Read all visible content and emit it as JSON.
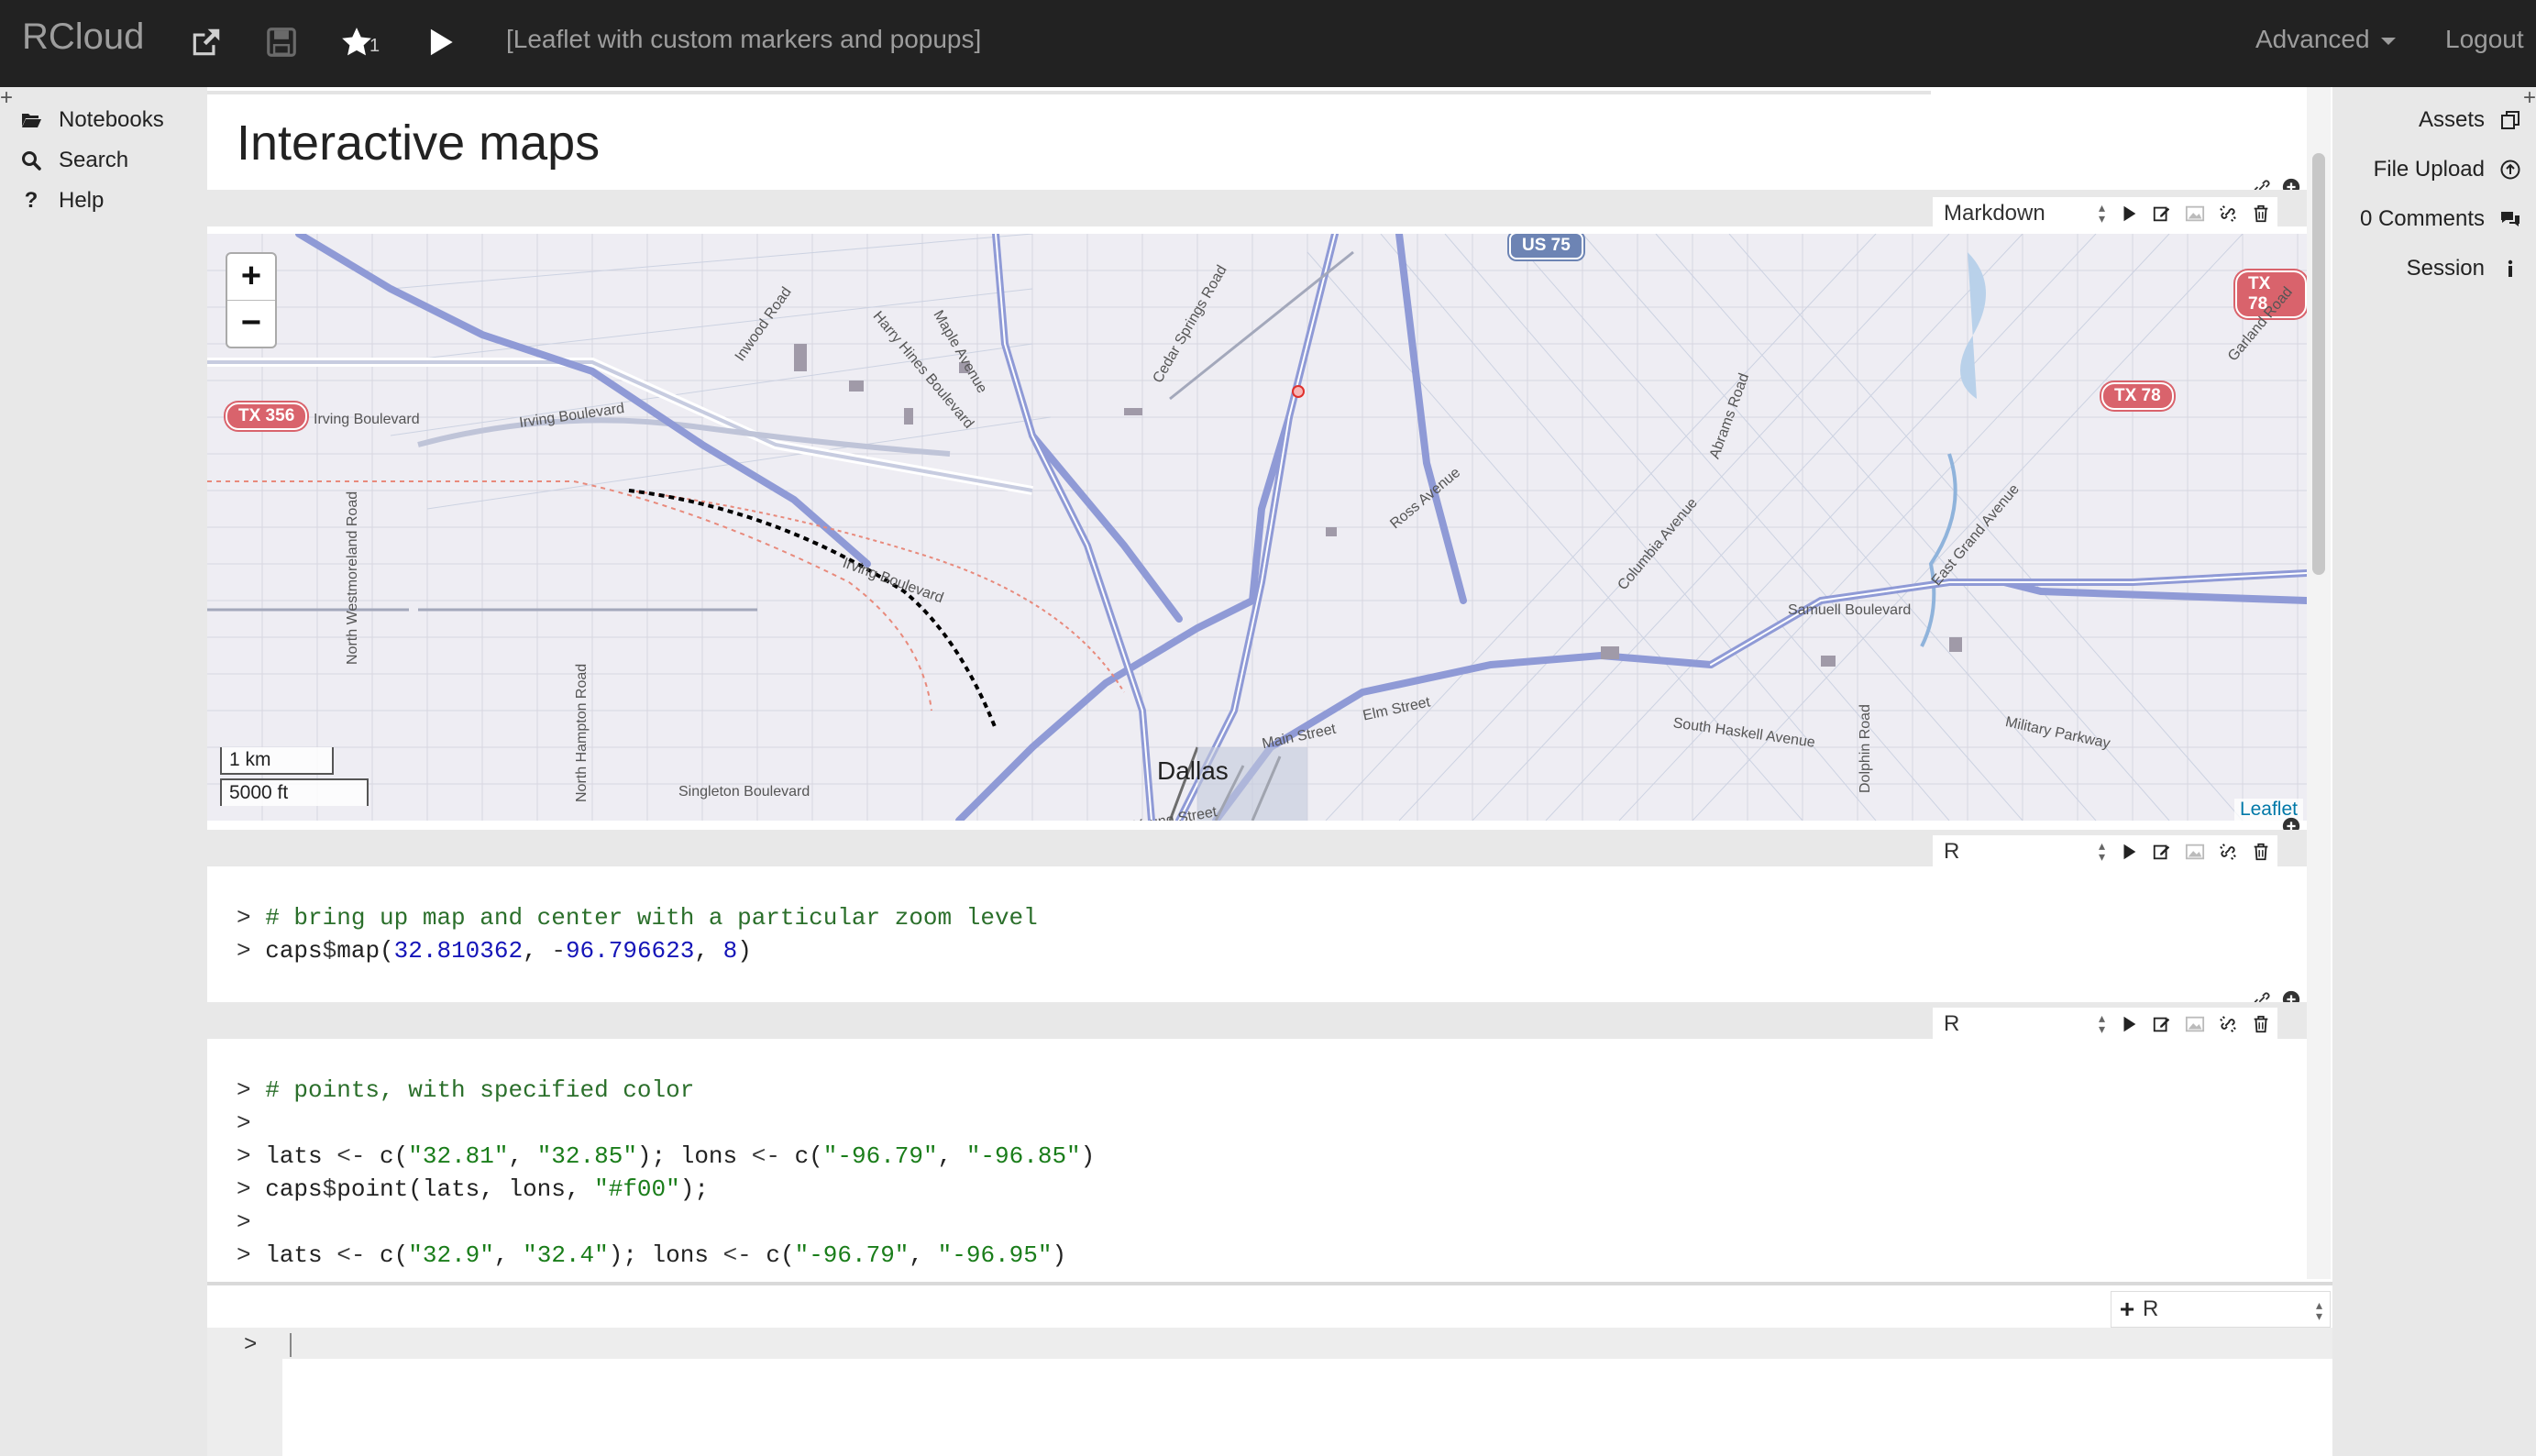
{
  "app": {
    "brand": "RCloud",
    "star_count": "1",
    "notebook_title": "[Leaflet with custom markers and popups]",
    "advanced_label": "Advanced",
    "logout_label": "Logout"
  },
  "left_panel": {
    "items": [
      {
        "label": "Notebooks",
        "icon": "folder-open-icon"
      },
      {
        "label": "Search",
        "icon": "search-icon"
      },
      {
        "label": "Help",
        "icon": "question-icon"
      }
    ]
  },
  "right_panel": {
    "items": [
      {
        "label": "Assets",
        "icon": "copy-icon"
      },
      {
        "label": "File Upload",
        "icon": "upload-circle-icon"
      },
      {
        "label": "0 Comments",
        "icon": "comments-icon"
      },
      {
        "label": "Session",
        "icon": "info-icon"
      }
    ]
  },
  "notebook": {
    "heading": "Interactive maps",
    "cells": [
      {
        "language": "Markdown"
      },
      {
        "language": "R",
        "lines": [
          "# bring up map and center with a particular zoom level",
          "caps$map(32.810362, -96.796623, 8)"
        ]
      },
      {
        "language": "R",
        "lines": [
          "# points, with specified color",
          "",
          "lats <- c(\"32.81\", \"32.85\"); lons <- c(\"-96.79\", \"-96.85\")",
          "caps$point(lats, lons, \"#f00\");",
          "",
          "lats <- c(\"32.9\", \"32.4\"); lons <- c(\"-96.79\", \"-96.95\")"
        ]
      }
    ]
  },
  "map": {
    "zoom_in": "+",
    "zoom_out": "−",
    "scale_metric": "1 km",
    "scale_imperial": "5000 ft",
    "attribution": "Leaflet",
    "city": "Dallas",
    "shields": [
      "US 75",
      "TX 78",
      "TX 78",
      "TX 356"
    ],
    "street_labels": [
      "Irving Boulevard",
      "Irving Boulevard",
      "Irving Boulevard",
      "Singleton Boulevard",
      "Samuell Boulevard",
      "South Haskell Avenue",
      "Military Parkway",
      "Columbia Avenue",
      "Ross Avenue",
      "Elm Street",
      "Main Street",
      "Young Street",
      "East Grand Avenue",
      "Garland Road",
      "Abrams Road",
      "North Westmoreland Road",
      "North Hampton Road",
      "Dolphin Road",
      "Maple Avenue",
      "Cedar Springs Road",
      "Harry Hines Boulevard",
      "Inwood Road"
    ]
  },
  "command": {
    "prompt": ">",
    "language": "R"
  },
  "colors": {
    "navbar": "#222222",
    "panel": "#e8e8e8",
    "comment": "#2b6f2b",
    "number": "#1515b8",
    "string": "#1a7d1a",
    "shield_red": "#d9636c",
    "shield_blue": "#6d84b4",
    "freeway": "#8f9ad6"
  }
}
